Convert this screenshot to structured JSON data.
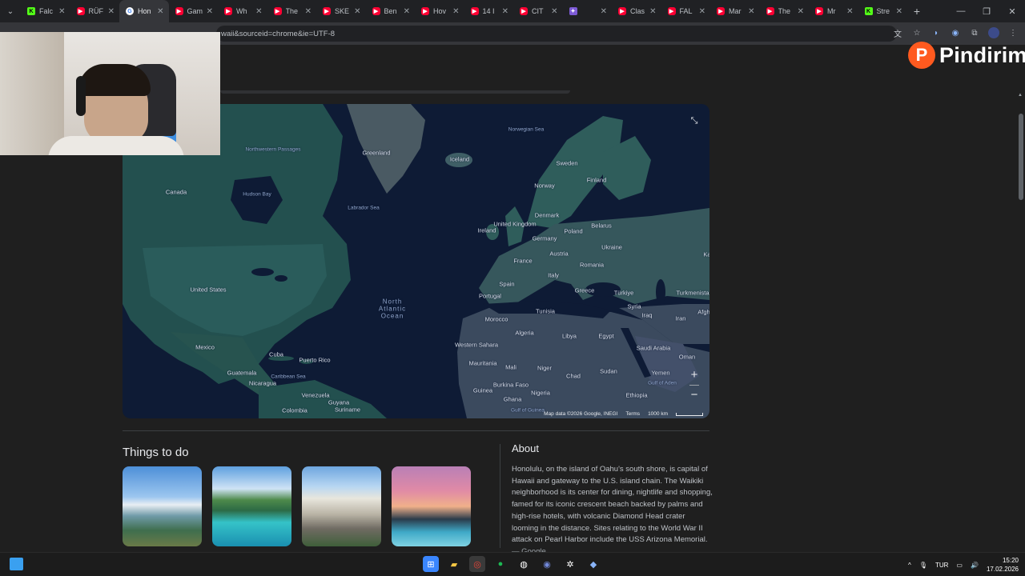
{
  "browser": {
    "tabs": [
      {
        "icon": "kick",
        "title": "Falc"
      },
      {
        "icon": "youtube",
        "title": "RÜF"
      },
      {
        "icon": "google",
        "title": "Hon",
        "active": true
      },
      {
        "icon": "youtube",
        "title": "Gam"
      },
      {
        "icon": "youtube",
        "title": "Wh"
      },
      {
        "icon": "youtube",
        "title": "The"
      },
      {
        "icon": "youtube",
        "title": "SKE"
      },
      {
        "icon": "youtube",
        "title": "Ben"
      },
      {
        "icon": "youtube",
        "title": "Hov"
      },
      {
        "icon": "youtube",
        "title": "14 I"
      },
      {
        "icon": "youtube",
        "title": "CIT"
      },
      {
        "icon": "purple",
        "title": ""
      },
      {
        "icon": "youtube",
        "title": "Clas"
      },
      {
        "icon": "youtube",
        "title": "FAL"
      },
      {
        "icon": "youtube",
        "title": "Mar"
      },
      {
        "icon": "youtube",
        "title": "The"
      },
      {
        "icon": "youtube",
        "title": "Mr"
      },
      {
        "icon": "kick",
        "title": "Stre"
      }
    ],
    "url": "waii&sourceid=chrome&ie=UTF-8"
  },
  "map": {
    "labels": [
      {
        "text": "Greenland"
      },
      {
        "text": "Iceland"
      },
      {
        "text": "Norwegian Sea",
        "kind": "water"
      },
      {
        "text": "Sweden"
      },
      {
        "text": "Finland"
      },
      {
        "text": "Norway"
      },
      {
        "text": "Northwestern Passages",
        "kind": "water"
      },
      {
        "text": "Canada"
      },
      {
        "text": "Hudson Bay",
        "kind": "water"
      },
      {
        "text": "Labrador Sea",
        "kind": "water"
      },
      {
        "text": "United Kingdom"
      },
      {
        "text": "Denmark"
      },
      {
        "text": "Ireland"
      },
      {
        "text": "Germany"
      },
      {
        "text": "Poland"
      },
      {
        "text": "Belarus"
      },
      {
        "text": "Ukraine"
      },
      {
        "text": "France"
      },
      {
        "text": "Austria"
      },
      {
        "text": "Romania"
      },
      {
        "text": "Italy"
      },
      {
        "text": "Spain"
      },
      {
        "text": "Portugal"
      },
      {
        "text": "Greece"
      },
      {
        "text": "Türkiye"
      },
      {
        "text": "Turkmenista"
      },
      {
        "text": "Syria"
      },
      {
        "text": "Iraq"
      },
      {
        "text": "Iran"
      },
      {
        "text": "Afgh"
      },
      {
        "text": "Ka"
      },
      {
        "text": "United States"
      },
      {
        "text": "North Atlantic Ocean",
        "kind": "ocean"
      },
      {
        "text": "Tunisia"
      },
      {
        "text": "Morocco"
      },
      {
        "text": "Algeria"
      },
      {
        "text": "Libya"
      },
      {
        "text": "Egypt"
      },
      {
        "text": "Saudi Arabia"
      },
      {
        "text": "Oman"
      },
      {
        "text": "Western Sahara"
      },
      {
        "text": "Mexico"
      },
      {
        "text": "Cuba"
      },
      {
        "text": "Puerto Rico"
      },
      {
        "text": "Mauritania"
      },
      {
        "text": "Mali"
      },
      {
        "text": "Niger"
      },
      {
        "text": "Chad"
      },
      {
        "text": "Sudan"
      },
      {
        "text": "Yemen"
      },
      {
        "text": "Guatemala"
      },
      {
        "text": "Caribbean Sea",
        "kind": "water"
      },
      {
        "text": "Nicaragua"
      },
      {
        "text": "Burkina Faso"
      },
      {
        "text": "Nigeria"
      },
      {
        "text": "Gulf of Aden",
        "kind": "water"
      },
      {
        "text": "Ethiopia"
      },
      {
        "text": "Venezuela"
      },
      {
        "text": "Guyana"
      },
      {
        "text": "Suriname"
      },
      {
        "text": "Guinea"
      },
      {
        "text": "Ghana"
      },
      {
        "text": "Colombia"
      },
      {
        "text": "Gulf of Guinea",
        "kind": "water"
      }
    ],
    "attribution": "Map data ©2026 Google, INEGI",
    "terms": "Terms",
    "scale": "1000 km"
  },
  "things_to_do": {
    "title": "Things to do"
  },
  "about": {
    "title": "About",
    "text": "Honolulu, on the island of Oahu's south shore, is capital of Hawaii and gateway to the U.S. island chain. The Waikiki neighborhood is its center for dining, nightlife and shopping, famed for its iconic crescent beach backed by palms and high-rise hotels, with volcanic Diamond Head crater looming in the distance. Sites relating to the World War II attack on Pearl Harbor include the USS Arizona Memorial.",
    "source": "— Google"
  },
  "overlay": {
    "logo_letter": "P",
    "logo_text": "Pindirim"
  },
  "taskbar": {
    "lang": "TUR",
    "time": "15:20",
    "date": "17.02.2026"
  }
}
